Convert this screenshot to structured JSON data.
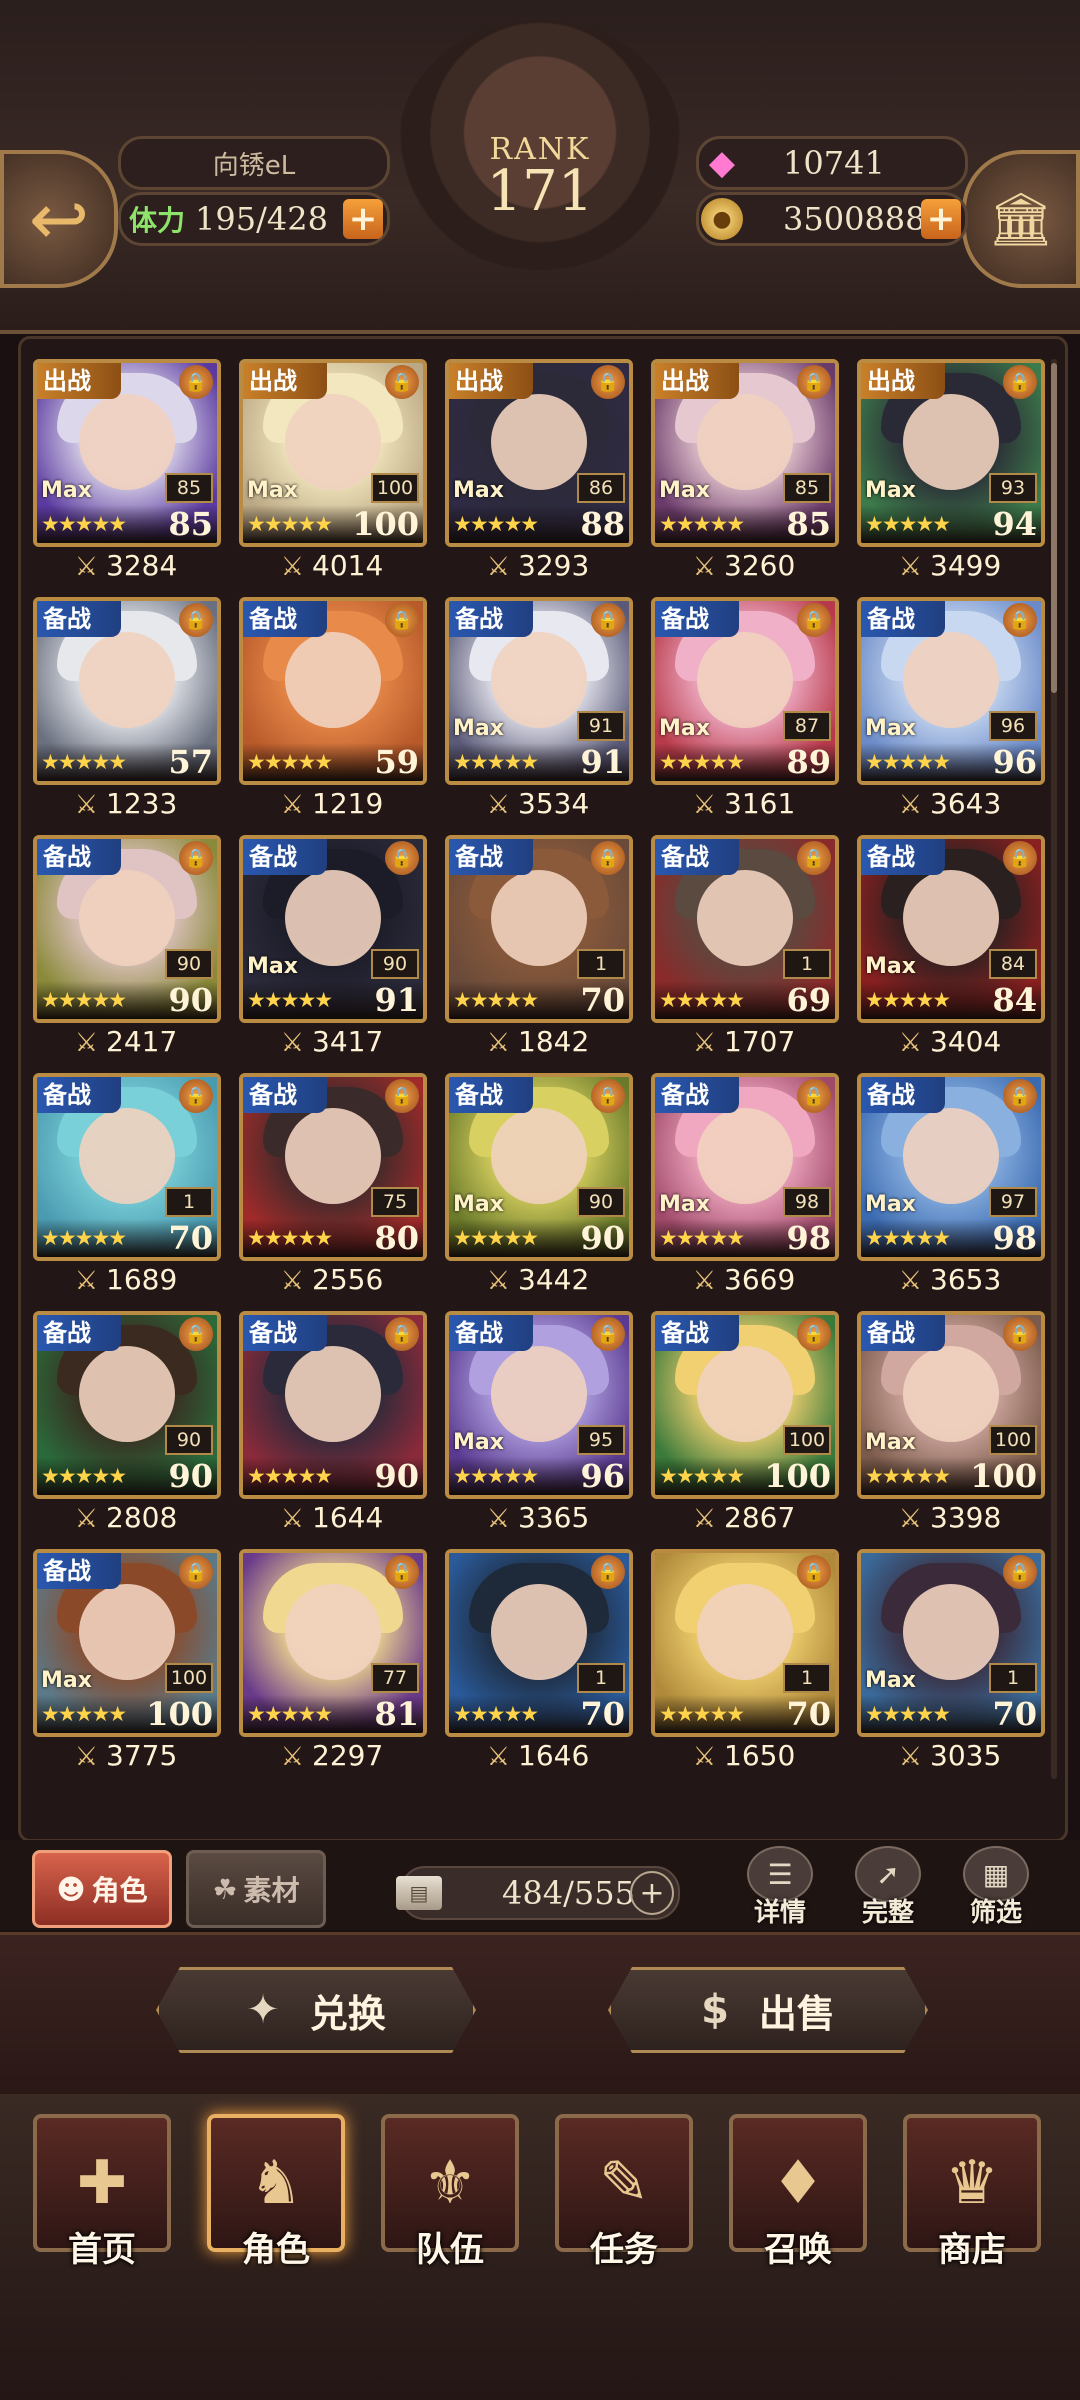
{
  "header": {
    "player_name": "向锈eL",
    "stamina_label": "体力",
    "stamina": "195/428",
    "rank_label": "RANK",
    "rank": "171",
    "gems": "10741",
    "gold": "3500888"
  },
  "cards": [
    {
      "tag": "出战",
      "out": true,
      "max": true,
      "small": "85",
      "level": "85",
      "power": "3284",
      "art": [
        "#5b3aa0",
        "#dcd7ea"
      ]
    },
    {
      "tag": "出战",
      "out": true,
      "max": true,
      "small": "100",
      "level": "100",
      "power": "4014",
      "art": [
        "#bba884",
        "#f2e7be"
      ]
    },
    {
      "tag": "出战",
      "out": true,
      "max": true,
      "small": "86",
      "level": "88",
      "power": "3293",
      "art": [
        "#2e2a44",
        "#2c2a38"
      ]
    },
    {
      "tag": "出战",
      "out": true,
      "max": true,
      "small": "85",
      "level": "85",
      "power": "3260",
      "art": [
        "#6a3a6a",
        "#e6c8d0"
      ]
    },
    {
      "tag": "出战",
      "out": true,
      "max": true,
      "small": "93",
      "level": "94",
      "power": "3499",
      "art": [
        "#3c7a4a",
        "#2a2a36"
      ]
    },
    {
      "tag": "备战",
      "out": false,
      "max": false,
      "small": "",
      "level": "57",
      "power": "1233",
      "art": [
        "#6a7080",
        "#e6e8ec"
      ]
    },
    {
      "tag": "备战",
      "out": false,
      "max": false,
      "small": "",
      "level": "59",
      "power": "1219",
      "art": [
        "#b85a2a",
        "#e88a4a"
      ]
    },
    {
      "tag": "备战",
      "out": false,
      "max": true,
      "small": "91",
      "level": "91",
      "power": "3534",
      "art": [
        "#5a5a78",
        "#e8e8f0"
      ]
    },
    {
      "tag": "备战",
      "out": false,
      "max": true,
      "small": "87",
      "level": "89",
      "power": "3161",
      "art": [
        "#b83a4a",
        "#f0b0c8"
      ]
    },
    {
      "tag": "备战",
      "out": false,
      "max": true,
      "small": "96",
      "level": "96",
      "power": "3643",
      "art": [
        "#6a8ac8",
        "#c8d8f0"
      ]
    },
    {
      "tag": "备战",
      "out": false,
      "max": false,
      "small": "90",
      "level": "90",
      "power": "2417",
      "art": [
        "#8a8a3a",
        "#e0c4c4"
      ]
    },
    {
      "tag": "备战",
      "out": false,
      "max": true,
      "small": "90",
      "level": "91",
      "power": "3417",
      "art": [
        "#2a2a3a",
        "#1c1c28"
      ]
    },
    {
      "tag": "备战",
      "out": false,
      "max": false,
      "small": "1",
      "level": "70",
      "power": "1842",
      "art": [
        "#6a4a3a",
        "#8a5a3a"
      ]
    },
    {
      "tag": "备战",
      "out": false,
      "max": false,
      "small": "1",
      "level": "69",
      "power": "1707",
      "art": [
        "#8a2a2a",
        "#5a4a40"
      ]
    },
    {
      "tag": "备战",
      "out": false,
      "max": true,
      "small": "84",
      "level": "84",
      "power": "3404",
      "art": [
        "#8a2020",
        "#2a2020"
      ]
    },
    {
      "tag": "备战",
      "out": false,
      "max": false,
      "small": "1",
      "level": "70",
      "power": "1689",
      "art": [
        "#4a9ab0",
        "#7ad0d8"
      ]
    },
    {
      "tag": "备战",
      "out": false,
      "max": false,
      "small": "75",
      "level": "80",
      "power": "2556",
      "art": [
        "#a02a2a",
        "#3a2a2a"
      ]
    },
    {
      "tag": "备战",
      "out": false,
      "max": true,
      "small": "90",
      "level": "90",
      "power": "3442",
      "art": [
        "#6a7a2a",
        "#d8d060"
      ]
    },
    {
      "tag": "备战",
      "out": false,
      "max": true,
      "small": "98",
      "level": "98",
      "power": "3669",
      "art": [
        "#a04a6a",
        "#f0a8c0"
      ]
    },
    {
      "tag": "备战",
      "out": false,
      "max": true,
      "small": "97",
      "level": "98",
      "power": "3653",
      "art": [
        "#3a6ab0",
        "#8ab0e0"
      ]
    },
    {
      "tag": "备战",
      "out": false,
      "max": false,
      "small": "90",
      "level": "90",
      "power": "2808",
      "art": [
        "#2a6a3a",
        "#3a2a20"
      ]
    },
    {
      "tag": "备战",
      "out": false,
      "max": false,
      "small": "",
      "level": "90",
      "power": "1644",
      "art": [
        "#8a2a3a",
        "#2a2a3a"
      ]
    },
    {
      "tag": "备战",
      "out": false,
      "max": true,
      "small": "95",
      "level": "96",
      "power": "3365",
      "art": [
        "#5a3a90",
        "#b0a0e0"
      ]
    },
    {
      "tag": "备战",
      "out": false,
      "max": false,
      "small": "100",
      "level": "100",
      "power": "2867",
      "art": [
        "#3a7a3a",
        "#f0d070"
      ]
    },
    {
      "tag": "备战",
      "out": false,
      "max": true,
      "small": "100",
      "level": "100",
      "power": "3398",
      "art": [
        "#7a5a4a",
        "#d0a8a0"
      ]
    },
    {
      "tag": "备战",
      "out": false,
      "max": true,
      "small": "100",
      "level": "100",
      "power": "3775",
      "art": [
        "#5a7a8a",
        "#8a4a2a"
      ]
    },
    {
      "tag": "",
      "out": false,
      "max": false,
      "small": "77",
      "level": "81",
      "power": "2297",
      "art": [
        "#6a3a8a",
        "#f0d890"
      ]
    },
    {
      "tag": "",
      "out": false,
      "max": false,
      "small": "1",
      "level": "70",
      "power": "1646",
      "art": [
        "#2a5a9a",
        "#1e2a3a"
      ]
    },
    {
      "tag": "",
      "out": false,
      "max": false,
      "small": "1",
      "level": "70",
      "power": "1650",
      "art": [
        "#b08a3a",
        "#f0d070"
      ]
    },
    {
      "tag": "",
      "out": false,
      "max": true,
      "small": "1",
      "level": "70",
      "power": "3035",
      "art": [
        "#3a6a9a",
        "#3a2a3a"
      ]
    }
  ],
  "toolbar": {
    "tab_role": "角色",
    "tab_material": "素材",
    "capacity": "484/555",
    "detail": "详情",
    "complete": "完整",
    "filter": "筛选"
  },
  "actions": {
    "exchange": "兑换",
    "sell": "出售"
  },
  "nav": [
    {
      "label": "首页",
      "icon": "home-banner-icon"
    },
    {
      "label": "角色",
      "icon": "character-book-icon",
      "active": true
    },
    {
      "label": "队伍",
      "icon": "team-shield-icon"
    },
    {
      "label": "任务",
      "icon": "quest-book-icon"
    },
    {
      "label": "召唤",
      "icon": "summon-card-icon"
    },
    {
      "label": "商店",
      "icon": "shop-gem-icon"
    }
  ],
  "stars": "★★★★★",
  "max_label": "Max"
}
